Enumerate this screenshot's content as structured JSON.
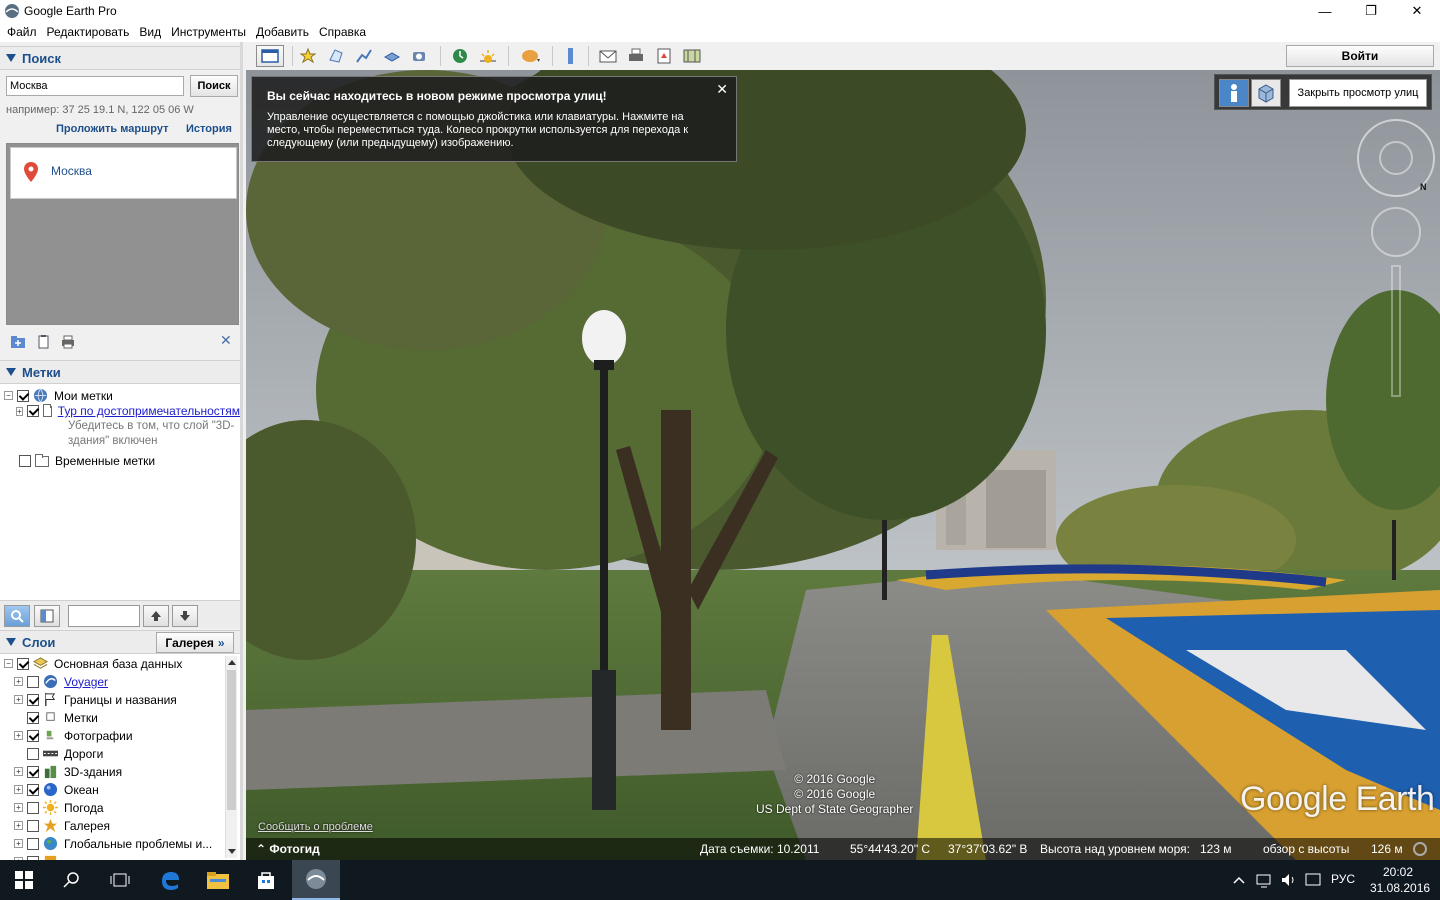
{
  "window": {
    "title": "Google Earth Pro",
    "minimize_glyph": "—",
    "maximize_glyph": "❐",
    "close_glyph": "✕"
  },
  "menu": [
    "Файл",
    "Редактировать",
    "Вид",
    "Инструменты",
    "Добавить",
    "Справка"
  ],
  "search": {
    "header": "Поиск",
    "input_value": "Москва",
    "button": "Поиск",
    "hint": "например: 37 25 19.1 N, 122 05 06 W",
    "route_link": "Проложить маршрут",
    "history_link": "История",
    "result": "Москва",
    "close_glyph": "✕"
  },
  "places": {
    "header": "Метки",
    "items": [
      {
        "label": "Мои метки",
        "checked": true
      },
      {
        "label": "Тур по достопримечательностям",
        "checked": true
      },
      {
        "label": "Убедитесь в том, что слой \"3D-",
        "checked": false
      },
      {
        "label": "здания\" включен",
        "checked": false
      },
      {
        "label": "Временные метки",
        "checked": false
      }
    ]
  },
  "layers": {
    "header": "Слои",
    "gallery_button": "Галерея",
    "gallery_chevron": "»",
    "items": [
      {
        "label": "Основная база данных",
        "checked": true
      },
      {
        "label": "Voyager",
        "checked": false
      },
      {
        "label": "Границы и названия",
        "checked": true
      },
      {
        "label": "Метки",
        "checked": true
      },
      {
        "label": "Фотографии",
        "checked": true
      },
      {
        "label": "Дороги",
        "checked": false
      },
      {
        "label": "3D-здания",
        "checked": true
      },
      {
        "label": "Океан",
        "checked": true
      },
      {
        "label": "Погода",
        "checked": false
      },
      {
        "label": "Галерея",
        "checked": false
      },
      {
        "label": "Глобальные проблемы и...",
        "checked": false
      }
    ]
  },
  "toolbar": {
    "login_button": "Войти"
  },
  "streetview": {
    "tooltip_title": "Вы сейчас находитесь в новом режиме просмотра улиц!",
    "tooltip_body": "Управление осуществляется с помощью джойстика или клавиатуры. Нажмите на место, чтобы переместиться туда. Колесо прокрутки используется для перехода к следующему (или предыдущему) изображению.",
    "tooltip_close": "✕",
    "close_button": "Закрыть просмотр улиц",
    "compass_north": "N",
    "copyright": [
      "© 2016 Google",
      "© 2016 Google",
      "US Dept of State Geographer"
    ],
    "report_link": "Сообщить о проблеме",
    "logo": "Google Earth",
    "tour_guide": "Фотогид",
    "tour_guide_glyph": "⌃"
  },
  "status": {
    "date": "Дата съемки: 10.2011",
    "lat": "55°44'43.20\" С",
    "lon": "37°37'03.62\" В",
    "elevation": "Высота над уровнем моря:   123 м",
    "eye_alt": "обзор с высоты",
    "eye_alt_value": "126 м"
  },
  "taskbar": {
    "language": "РУС",
    "time": "20:02",
    "date": "31.08.2016"
  }
}
